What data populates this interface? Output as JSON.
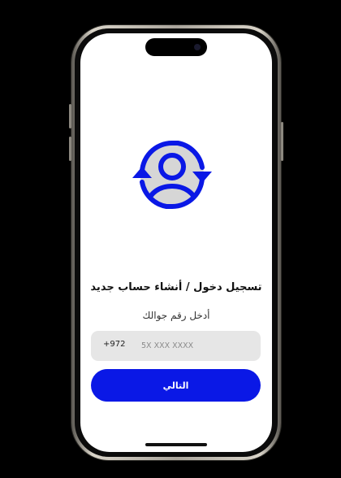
{
  "screen": {
    "title": "تسجيل دخول / أنشاء حساب جديد",
    "subtitle": "أدخل رقم جوالك",
    "hero_icon": "user-sync-icon",
    "accent_color": "#0a18e6"
  },
  "phone_input": {
    "country_code": "+972",
    "placeholder": "5X XXX XXXX",
    "value": ""
  },
  "actions": {
    "next_label": "التالي"
  }
}
